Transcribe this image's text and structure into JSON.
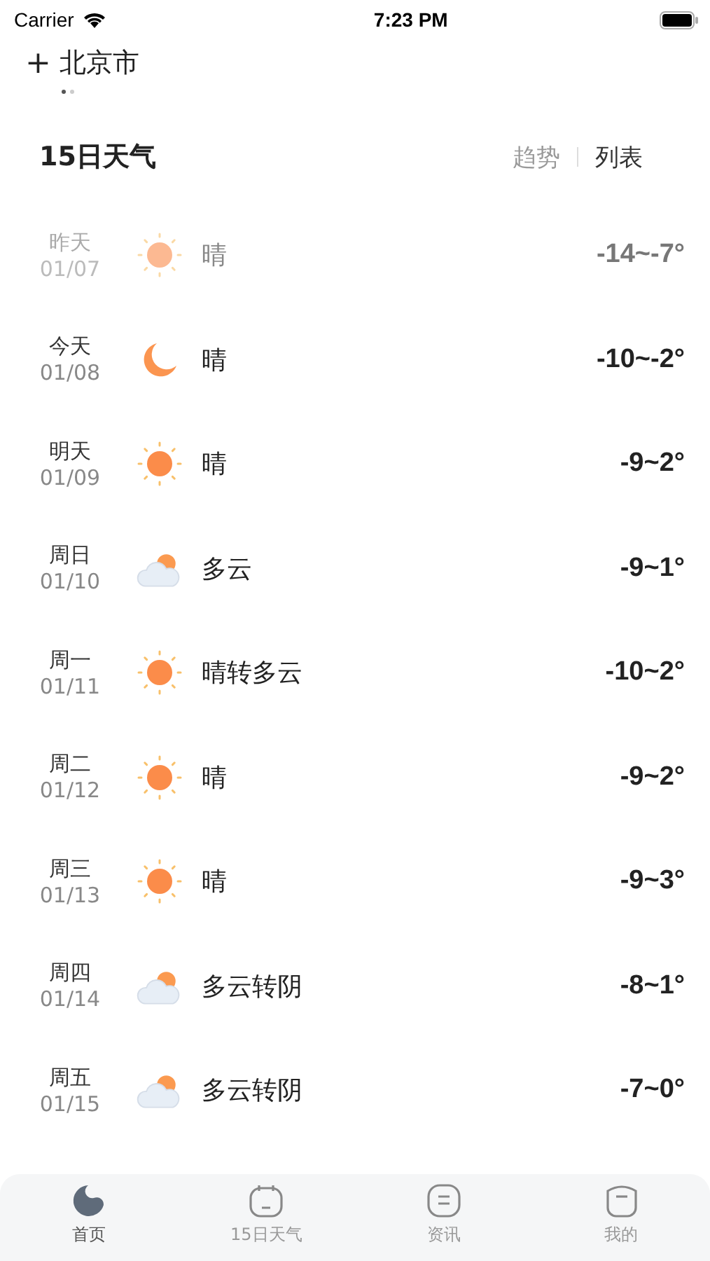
{
  "status_bar": {
    "carrier": "Carrier",
    "time": "7:23 PM"
  },
  "header": {
    "city": "北京市",
    "add_icon": "+",
    "pages": [
      {
        "selected": true
      },
      {
        "selected": false
      }
    ]
  },
  "forecast": {
    "title": "15日天气",
    "views": [
      {
        "label": "趋势",
        "selected": false
      },
      {
        "label": "列表",
        "selected": true
      }
    ],
    "days": [
      {
        "day": "昨天",
        "date": "01/07",
        "kind": "sun",
        "condition": "晴",
        "temp": "-14~-7°",
        "past": true
      },
      {
        "day": "今天",
        "date": "01/08",
        "kind": "moon",
        "condition": "晴",
        "temp": "-10~-2°",
        "past": false
      },
      {
        "day": "明天",
        "date": "01/09",
        "kind": "sun",
        "condition": "晴",
        "temp": "-9~2°",
        "past": false
      },
      {
        "day": "周日",
        "date": "01/10",
        "kind": "cloud",
        "condition": "多云",
        "temp": "-9~1°",
        "past": false
      },
      {
        "day": "周一",
        "date": "01/11",
        "kind": "sun",
        "condition": "晴转多云",
        "temp": "-10~2°",
        "past": false
      },
      {
        "day": "周二",
        "date": "01/12",
        "kind": "sun",
        "condition": "晴",
        "temp": "-9~2°",
        "past": false
      },
      {
        "day": "周三",
        "date": "01/13",
        "kind": "sun",
        "condition": "晴",
        "temp": "-9~3°",
        "past": false
      },
      {
        "day": "周四",
        "date": "01/14",
        "kind": "cloud",
        "condition": "多云转阴",
        "temp": "-8~1°",
        "past": false
      },
      {
        "day": "周五",
        "date": "01/15",
        "kind": "cloud",
        "condition": "多云转阴",
        "temp": "-7~0°",
        "past": false
      }
    ]
  },
  "tab_bar": [
    {
      "label": "首页",
      "kind": "home",
      "selected": true
    },
    {
      "label": "15日天气",
      "kind": "calendar",
      "selected": false
    },
    {
      "label": "资讯",
      "kind": "news",
      "selected": false
    },
    {
      "label": "我的",
      "kind": "profile",
      "selected": false
    }
  ]
}
